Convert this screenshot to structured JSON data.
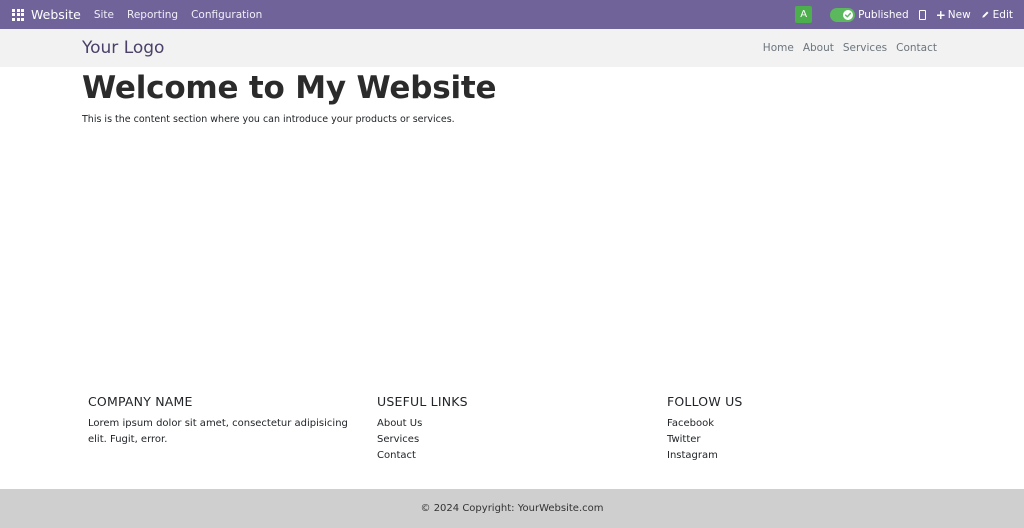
{
  "admin_bar": {
    "app_name": "Website",
    "menu": [
      "Site",
      "Reporting",
      "Configuration"
    ],
    "avatar_letter": "A",
    "published_label": "Published",
    "new_label": "New",
    "edit_label": "Edit",
    "bar_color": "#6f639a",
    "toggle_color": "#5cb85c",
    "avatar_color": "#4cae4c"
  },
  "header": {
    "logo": "Your Logo",
    "nav": [
      "Home",
      "About",
      "Services",
      "Contact"
    ]
  },
  "main": {
    "title": "Welcome to My Website",
    "text": "This is the content section where you can introduce your products or services."
  },
  "footer": {
    "company": {
      "heading": "COMPANY NAME",
      "text": "Lorem ipsum dolor sit amet, consectetur adipisicing elit. Fugit, error."
    },
    "links": {
      "heading": "USEFUL LINKS",
      "items": [
        "About Us",
        "Services",
        "Contact"
      ]
    },
    "follow": {
      "heading": "FOLLOW US",
      "items": [
        "Facebook",
        "Twitter",
        "Instagram"
      ]
    },
    "copyright": "© 2024 Copyright: YourWebsite.com"
  }
}
